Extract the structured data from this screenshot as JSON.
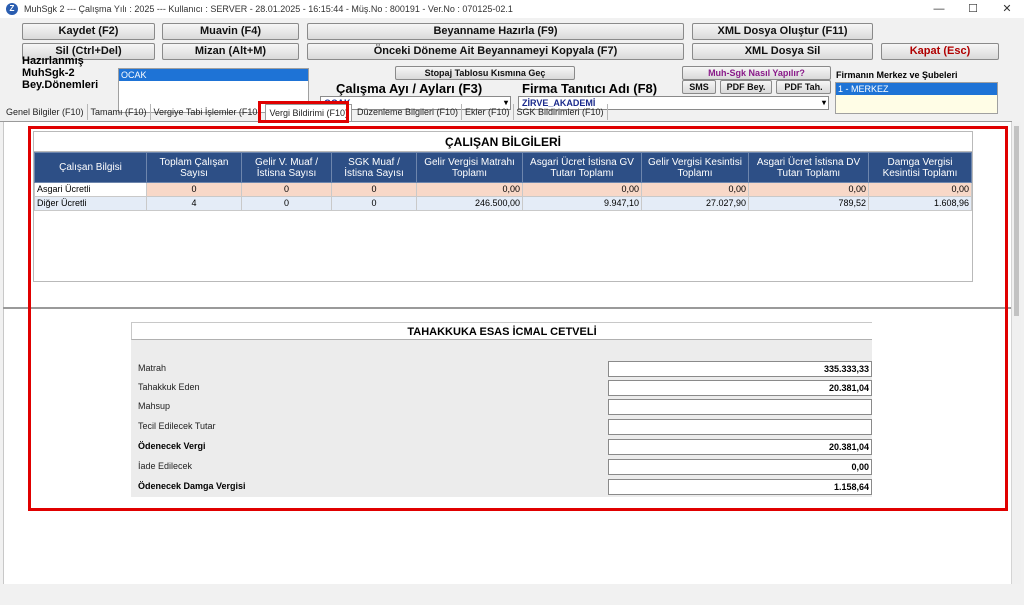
{
  "window": {
    "title": "MuhSgk 2  ---  Çalışma Yılı : 2025  ---  Kullanıcı : SERVER - 28.01.2025 - 16:15:44 - Müş.No : 800191 - Ver.No : 070125-02.1",
    "minimize": "—",
    "maximize": "☐",
    "close": "✕"
  },
  "toolbar": {
    "kaydet": "Kaydet (F2)",
    "muavin": "Muavin (F4)",
    "beyanname_hazirla": "Beyanname Hazırla (F9)",
    "xml_olustur": "XML Dosya Oluştur (F11)",
    "sil": "Sil (Ctrl+Del)",
    "mizan": "Mizan (Alt+M)",
    "onceki_donem": "Önceki Döneme Ait Beyannameyi Kopyala (F7)",
    "xml_sil": "XML Dosya Sil",
    "kapat": "Kapat (Esc)"
  },
  "header": {
    "hazirlanmis_label": "Hazırlanmış MuhSgk-2 Bey.Dönemleri",
    "hazirlanmis_selected": "OCAK",
    "stopaj_button": "Stopaj Tablosu Kısmına Geç",
    "calisma_ayi_label": "Çalışma Ayı / Ayları (F3)",
    "calisma_ayi_value": "OCAK",
    "firma_label": "Firma Tanıtıcı Adı (F8)",
    "firma_value": "ZİRVE_AKADEMİ",
    "nasil_yapilir": "Muh-Sgk Nasıl Yapılır?",
    "sms": "SMS",
    "pdf_bey": "PDF Bey.",
    "pdf_tah": "PDF Tah.",
    "sube_label": "Firmanın Merkez ve Şubeleri",
    "sube_selected": "1 - MERKEZ"
  },
  "tabs": [
    "Genel Bilgiler (F10)",
    "Tamamı (F10)",
    "Vergiye Tabi İşlemler (F10",
    "Vergi Bildirimi (F10)",
    "Düzenleme Bilgileri (F10)",
    "Ekler (F10)",
    "SGK Bildirimleri (F10)"
  ],
  "calisan": {
    "title": "ÇALIŞAN BİLGİLERİ",
    "columns": [
      "Çalışan Bilgisi",
      "Toplam Çalışan Sayısı",
      "Gelir V. Muaf / İstisna Sayısı",
      "SGK Muaf / İstisna Sayısı",
      "Gelir Vergisi Matrahı Toplamı",
      "Asgari Ücret İstisna GV Tutarı Toplamı",
      "Gelir Vergisi Kesintisi Toplamı",
      "Asgari Ücret İstisna DV Tutarı Toplamı",
      "Damga Vergisi Kesintisi Toplamı"
    ],
    "rows": [
      [
        "Asgari Ücretli",
        "0",
        "0",
        "0",
        "0,00",
        "0,00",
        "0,00",
        "0,00",
        "0,00"
      ],
      [
        "Diğer Ücretli",
        "4",
        "0",
        "0",
        "246.500,00",
        "9.947,10",
        "27.027,90",
        "789,52",
        "1.608,96"
      ]
    ]
  },
  "icmal": {
    "title": "TAHAKKUKA ESAS İCMAL CETVELİ",
    "rows": [
      {
        "label": "Matrah",
        "value": "335.333,33",
        "bold": false
      },
      {
        "label": "Tahakkuk Eden",
        "value": "20.381,04",
        "bold": false
      },
      {
        "label": "Mahsup",
        "value": "",
        "bold": false
      },
      {
        "label": "Tecil Edilecek Tutar",
        "value": "",
        "bold": false
      },
      {
        "label": "Ödenecek Vergi",
        "value": "20.381,04",
        "bold": true
      },
      {
        "label": "İade Edilecek",
        "value": "0,00",
        "bold": false
      },
      {
        "label": "Ödenecek Damga Vergisi",
        "value": "1.158,64",
        "bold": true
      }
    ]
  },
  "colors": {
    "header_blue": "#2d4f86",
    "selection_blue": "#1e73d6",
    "highlight_red": "#e00000",
    "asgari_row": "#f8d8c8",
    "diger_row": "#e4ecf7"
  }
}
